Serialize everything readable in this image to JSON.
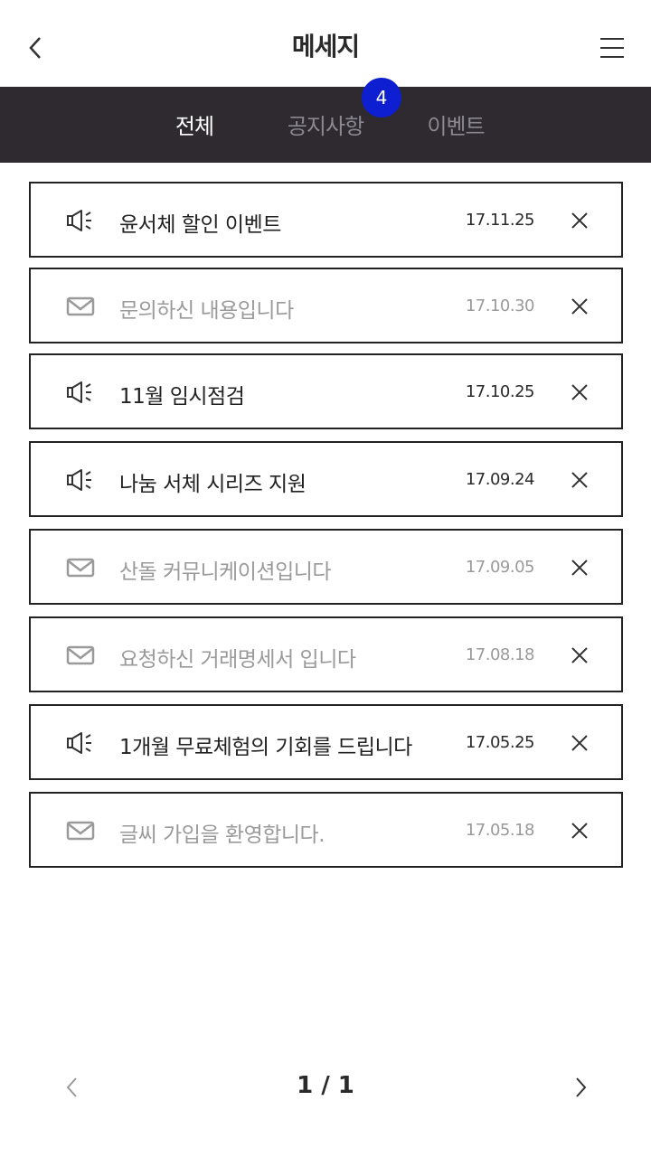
{
  "header": {
    "title": "메세지",
    "back_icon": "chevron-left-icon",
    "menu_icon": "hamburger-menu-icon"
  },
  "tabs": [
    {
      "label": "전체",
      "active": true
    },
    {
      "label": "공지사항",
      "active": false,
      "badge": "4"
    },
    {
      "label": "이벤트",
      "active": false
    }
  ],
  "colors": {
    "tabbar_bg": "#2e2a30",
    "badge": "#0d1fd0",
    "unread_text": "#222222",
    "read_text": "#9a9a9a"
  },
  "messages": [
    {
      "type": "notice",
      "icon": "megaphone-icon",
      "title": "윤서체 할인 이벤트",
      "date": "17.11.25",
      "read": false
    },
    {
      "type": "mail",
      "icon": "envelope-icon",
      "title": "문의하신 내용입니다",
      "date": "17.10.30",
      "read": true
    },
    {
      "type": "notice",
      "icon": "megaphone-icon",
      "title": "11월 임시점검",
      "date": "17.10.25",
      "read": false
    },
    {
      "type": "notice",
      "icon": "megaphone-icon",
      "title": "나눔 서체 시리즈 지원",
      "date": "17.09.24",
      "read": false
    },
    {
      "type": "mail",
      "icon": "envelope-icon",
      "title": "산돌 커뮤니케이션입니다",
      "date": "17.09.05",
      "read": true
    },
    {
      "type": "mail",
      "icon": "envelope-icon",
      "title": "요청하신 거래명세서 입니다",
      "date": "17.08.18",
      "read": true
    },
    {
      "type": "notice",
      "icon": "megaphone-icon",
      "title": "1개월 무료체험의 기회를 드립니다",
      "date": "17.05.25",
      "read": false
    },
    {
      "type": "mail",
      "icon": "envelope-icon",
      "title": "글씨 가입을 환영합니다.",
      "date": "17.05.18",
      "read": true
    }
  ],
  "pager": {
    "label": "1 / 1",
    "prev_icon": "chevron-left-icon",
    "next_icon": "chevron-right-icon"
  }
}
